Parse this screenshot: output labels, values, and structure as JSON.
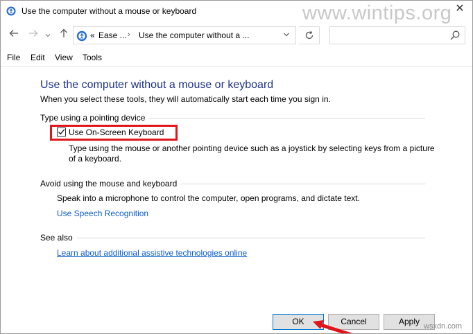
{
  "window": {
    "title": "Use the computer without a mouse or keyboard",
    "watermark": "www.wintips.org",
    "close_label": "✕"
  },
  "nav": {
    "back_icon": "arrow-left-icon",
    "forward_icon": "arrow-right-icon",
    "recent_icon": "chevron-down-icon",
    "up_icon": "arrow-up-icon",
    "address_prefix": "«",
    "breadcrumb": [
      "Ease ...",
      "Use the computer without a ..."
    ],
    "search_placeholder": ""
  },
  "menu": [
    "File",
    "Edit",
    "View",
    "Tools"
  ],
  "main": {
    "title": "Use the computer without a mouse or keyboard",
    "subtitle": "When you select these tools, they will automatically start each time you sign in.",
    "pointing": {
      "heading": "Type using a pointing device",
      "checkbox_label": "Use On-Screen Keyboard",
      "checked": true,
      "description": "Type using the mouse or another pointing device such as a joystick by selecting keys from a picture of a keyboard."
    },
    "avoid": {
      "heading": "Avoid using the mouse and keyboard",
      "description": "Speak into a microphone to control the computer, open programs, and dictate text.",
      "link": "Use Speech Recognition"
    },
    "see_also": {
      "heading": "See also",
      "link": "Learn about additional assistive technologies online"
    }
  },
  "buttons": {
    "ok": "OK",
    "cancel": "Cancel",
    "apply": "Apply"
  },
  "corner_mark": "wsxdn.com",
  "colors": {
    "title_blue": "#1e3287",
    "link_blue": "#0b5bcc",
    "highlight_red": "#e0151b"
  }
}
